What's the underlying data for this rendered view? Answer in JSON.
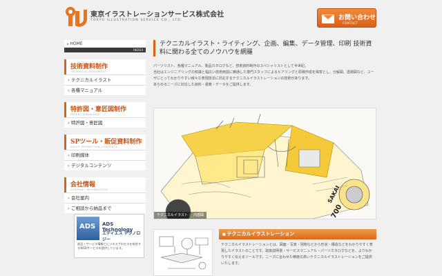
{
  "header": {
    "company_name": "東京イラストレーションサービス株式会社",
    "company_en": "TOKYO ILLUSTRATION SERVICE CO., LTD.",
    "contact_label": "お問い合わせ",
    "contact_sub": "CONTACT"
  },
  "sidebar": {
    "home": "HOME",
    "index": "INDEX",
    "sections": [
      {
        "title": "技術資料制作",
        "sub": "TECHNICAL DOCUMENT",
        "items": [
          "テクニカルイラスト",
          "各種マニュアル"
        ]
      },
      {
        "title": "特許図・意匠図制作",
        "sub": "PATENT DRAWINGS",
        "items": [
          "特許図・意匠図"
        ]
      },
      {
        "title": "SPツール・販促資料制作",
        "sub": "SALES PROMOTION CONTENTS",
        "items": [
          "印刷媒体",
          "デジタルコンテンツ"
        ]
      },
      {
        "title": "会社情報",
        "sub": "COMPANY INFORMATION",
        "items": [
          "会社案内",
          "ご相談から納品まで"
        ]
      }
    ]
  },
  "ads": {
    "logo": "ADS",
    "title": "ADS Technology",
    "subtitle": "エディエス テクノロジー",
    "desc": "部品・サービス情報とビジネスプロセスを結合するWEBサービスを提供しています。"
  },
  "main": {
    "lead": "テクニカルイラスト・ライティング、企画、編集、データ管理、印刷 技術資料に関わる全てのノウハウを網羅",
    "body": [
      "パーツリスト、各種マニュアル、製品カタログなど、技術資料制作のスペシャリストとして半世紀。",
      "当社はエンジニアリングの知識と幅広い技術用語に精通した専門スタッフによるヒアリングと原稿作成を得意とし、分解図、透視図など、ユーザにとってわかりやすい様々な表現技法に対応するテクニカルイラストレーションの技術があります。",
      "あらゆるニーズに対応した資料・書籍・データをご提供します。"
    ],
    "hero_caption": "テクニカルイラスト ： 内部図",
    "hero_brand": "SAKAI",
    "hero_model": "700"
  },
  "bottom": {
    "heading": "テクニカルイラストレーション",
    "text": "テクニカルイラストレーションとは、図面・写真・現物などから形状・構造などをわかりやすく表現したイラストのことです。取扱説明書・サービスマニュアル・パーツカタログなどを、よりわかりやすく伝えるツールです。ニーズに合わせた精度の高いテクニカルイラストレーションをご提供いたします。"
  },
  "colors": {
    "accent": "#d86416",
    "brand_blue": "#2c3f6a"
  }
}
